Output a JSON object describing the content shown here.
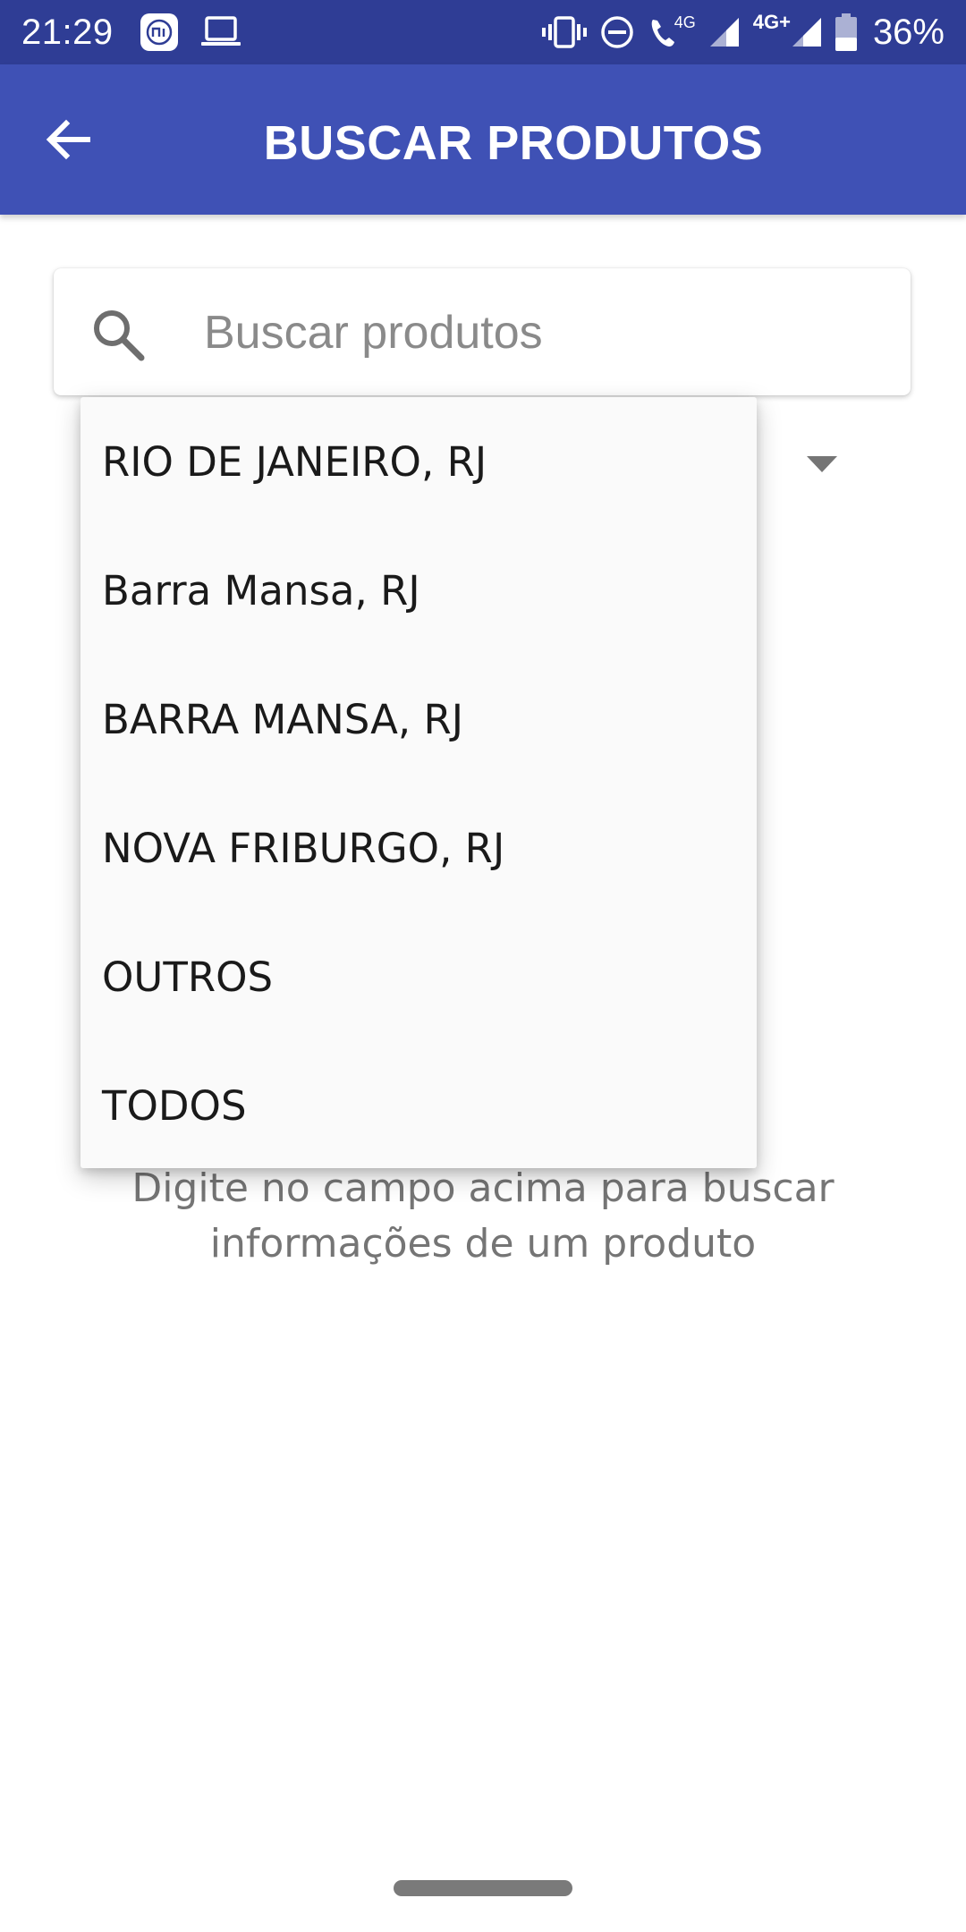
{
  "status_bar": {
    "time": "21:29",
    "network_primary": "4G",
    "network_secondary": "4G+",
    "battery": "36%",
    "icons": [
      "mi-icon",
      "laptop-icon",
      "vibrate-icon",
      "dnd-icon",
      "volte-call-icon",
      "signal-icon",
      "battery-icon"
    ]
  },
  "app_bar": {
    "title": "BUSCAR PRODUTOS",
    "back_icon": "arrow-back-icon"
  },
  "search": {
    "placeholder": "Buscar produtos",
    "value": "",
    "icon": "search-icon"
  },
  "dropdown": {
    "items": [
      {
        "label": "RIO DE JANEIRO, RJ"
      },
      {
        "label": "Barra Mansa, RJ"
      },
      {
        "label": "BARRA MANSA, RJ"
      },
      {
        "label": "NOVA FRIBURGO, RJ"
      },
      {
        "label": "OUTROS"
      },
      {
        "label": "TODOS"
      }
    ]
  },
  "hint": {
    "text": "Digite no campo acima para buscar informações de um produto"
  },
  "colors": {
    "status_bar": "#2f3d95",
    "app_bar": "#3f51b5",
    "hint_text": "#757575"
  }
}
